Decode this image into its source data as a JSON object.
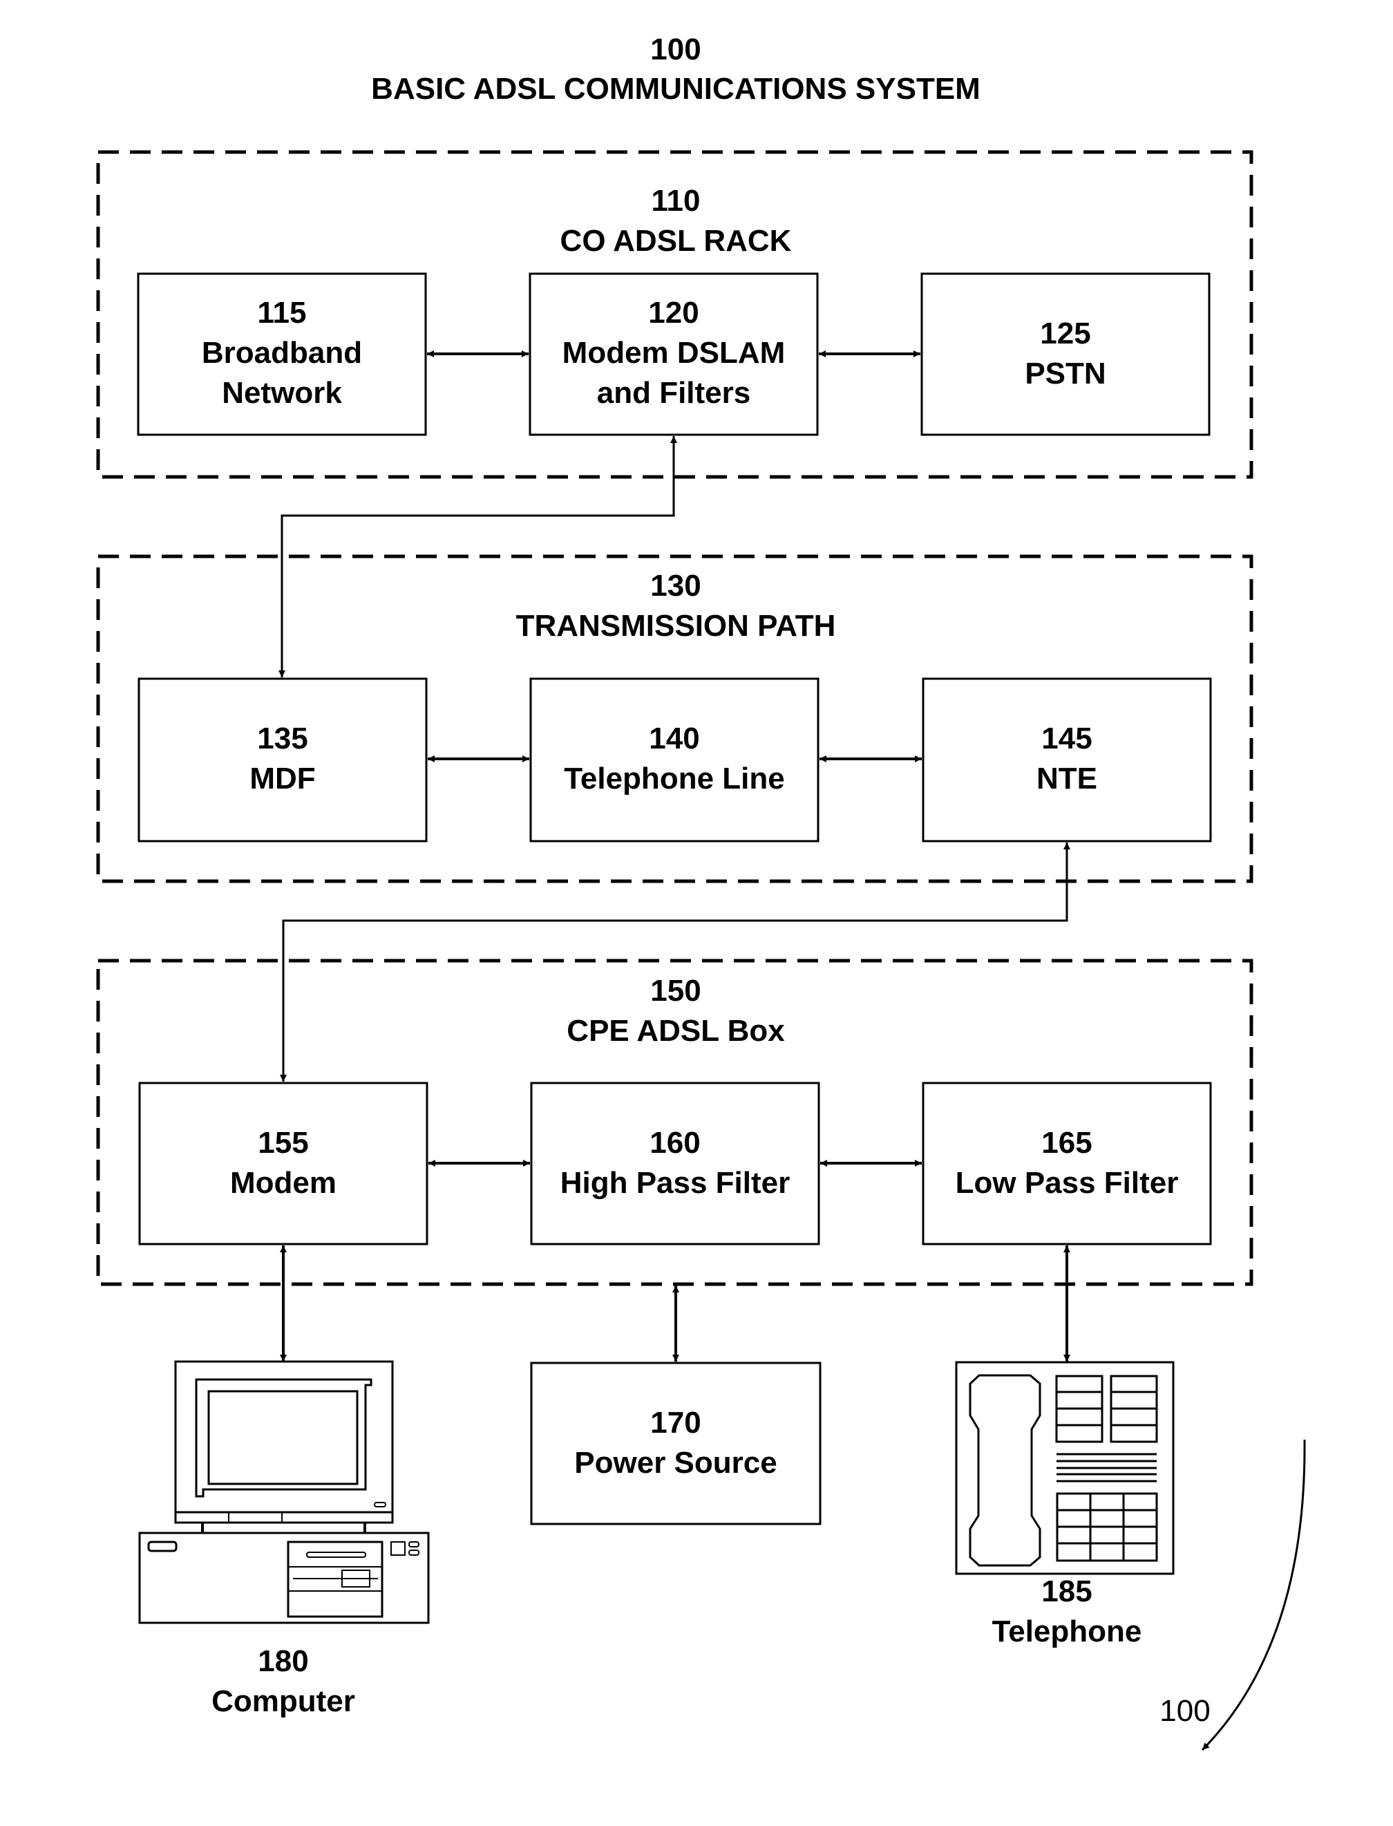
{
  "title": {
    "number": "100",
    "text": "BASIC ADSL COMMUNICATIONS SYSTEM"
  },
  "groups": [
    {
      "id": "co-adsl-rack",
      "number": "110",
      "label": "CO ADSL RACK"
    },
    {
      "id": "transmission-path",
      "number": "130",
      "label": "TRANSMISSION PATH"
    },
    {
      "id": "cpe-adsl-box",
      "number": "150",
      "label": "CPE ADSL Box"
    }
  ],
  "blocks": [
    {
      "id": "broadband-network",
      "number": "115",
      "lines": [
        "Broadband",
        "Network"
      ]
    },
    {
      "id": "modem-dslam",
      "number": "120",
      "lines": [
        "Modem DSLAM",
        "and Filters"
      ]
    },
    {
      "id": "pstn",
      "number": "125",
      "lines": [
        "PSTN"
      ]
    },
    {
      "id": "mdf",
      "number": "135",
      "lines": [
        "MDF"
      ]
    },
    {
      "id": "telephone-line",
      "number": "140",
      "lines": [
        "Telephone Line"
      ]
    },
    {
      "id": "nte",
      "number": "145",
      "lines": [
        "NTE"
      ]
    },
    {
      "id": "modem",
      "number": "155",
      "lines": [
        "Modem"
      ]
    },
    {
      "id": "high-pass-filter",
      "number": "160",
      "lines": [
        "High Pass Filter"
      ]
    },
    {
      "id": "low-pass-filter",
      "number": "165",
      "lines": [
        "Low Pass Filter"
      ]
    },
    {
      "id": "power-source",
      "number": "170",
      "lines": [
        "Power Source"
      ]
    }
  ],
  "devices": [
    {
      "id": "computer",
      "number": "180",
      "label": "Computer",
      "icon": "computer-icon"
    },
    {
      "id": "telephone",
      "number": "185",
      "label": "Telephone",
      "icon": "telephone-icon"
    }
  ],
  "connections": [
    {
      "from": "115",
      "to": "120",
      "direction": "bidirectional"
    },
    {
      "from": "120",
      "to": "125",
      "direction": "bidirectional"
    },
    {
      "from": "120",
      "to": "135",
      "direction": "bidirectional"
    },
    {
      "from": "135",
      "to": "140",
      "direction": "bidirectional"
    },
    {
      "from": "140",
      "to": "145",
      "direction": "bidirectional"
    },
    {
      "from": "145",
      "to": "155",
      "direction": "bidirectional"
    },
    {
      "from": "155",
      "to": "160",
      "direction": "bidirectional"
    },
    {
      "from": "160",
      "to": "165",
      "direction": "bidirectional"
    },
    {
      "from": "155",
      "to": "180",
      "direction": "bidirectional"
    },
    {
      "from": "150",
      "to": "170",
      "direction": "bidirectional"
    },
    {
      "from": "165",
      "to": "185",
      "direction": "bidirectional"
    }
  ],
  "figure_reference": "100"
}
